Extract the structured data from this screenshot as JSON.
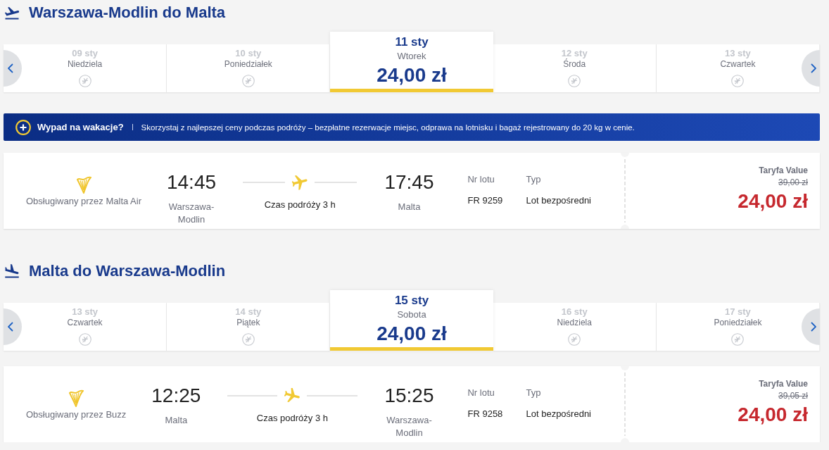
{
  "sections": [
    {
      "kind": "outbound",
      "title": "Warszawa-Modlin do Malta",
      "dates": [
        {
          "date": "09 sty",
          "day": "Niedziela",
          "selected": false
        },
        {
          "date": "10 sty",
          "day": "Poniedziałek",
          "selected": false
        },
        {
          "date": "11 sty",
          "day": "Wtorek",
          "price": "24,00 zł",
          "selected": true
        },
        {
          "date": "12 sty",
          "day": "Środa",
          "selected": false
        },
        {
          "date": "13 sty",
          "day": "Czwartek",
          "selected": false
        }
      ],
      "banner": {
        "heading": "Wypad na wakacje?",
        "text": "Skorzystaj z najlepszej ceny podczas podróży – bezpłatne rezerwacje miejsc, odprawa na lotnisku i bagaż rejestrowany do 20 kg w cenie."
      },
      "flight": {
        "operator": "Obsługiwany przez Malta Air",
        "departure_time": "14:45",
        "departure_city": "Warszawa-Modlin",
        "duration": "Czas podróży 3 h",
        "arrival_time": "17:45",
        "arrival_city": "Malta",
        "flight_number_label": "Nr lotu",
        "flight_number": "FR 9259",
        "type_label": "Typ",
        "type": "Lot bezpośredni",
        "fare_name": "Taryfa Value",
        "old_price": "39,00 zł",
        "price": "24,00 zł"
      }
    },
    {
      "kind": "inbound",
      "title": "Malta do Warszawa-Modlin",
      "dates": [
        {
          "date": "13 sty",
          "day": "Czwartek",
          "selected": false
        },
        {
          "date": "14 sty",
          "day": "Piątek",
          "selected": false
        },
        {
          "date": "15 sty",
          "day": "Sobota",
          "price": "24,00 zł",
          "selected": true
        },
        {
          "date": "16 sty",
          "day": "Niedziela",
          "selected": false
        },
        {
          "date": "17 sty",
          "day": "Poniedziałek",
          "selected": false
        }
      ],
      "flight": {
        "operator": "Obsługiwany przez Buzz",
        "departure_time": "12:25",
        "departure_city": "Malta",
        "duration": "Czas podróży 3 h",
        "arrival_time": "15:25",
        "arrival_city": "Warszawa-Modlin",
        "flight_number_label": "Nr lotu",
        "flight_number": "FR 9258",
        "type_label": "Typ",
        "type": "Lot bezpośredni",
        "fare_name": "Taryfa Value",
        "old_price": "39,05 zł",
        "price": "24,00 zł"
      }
    }
  ]
}
